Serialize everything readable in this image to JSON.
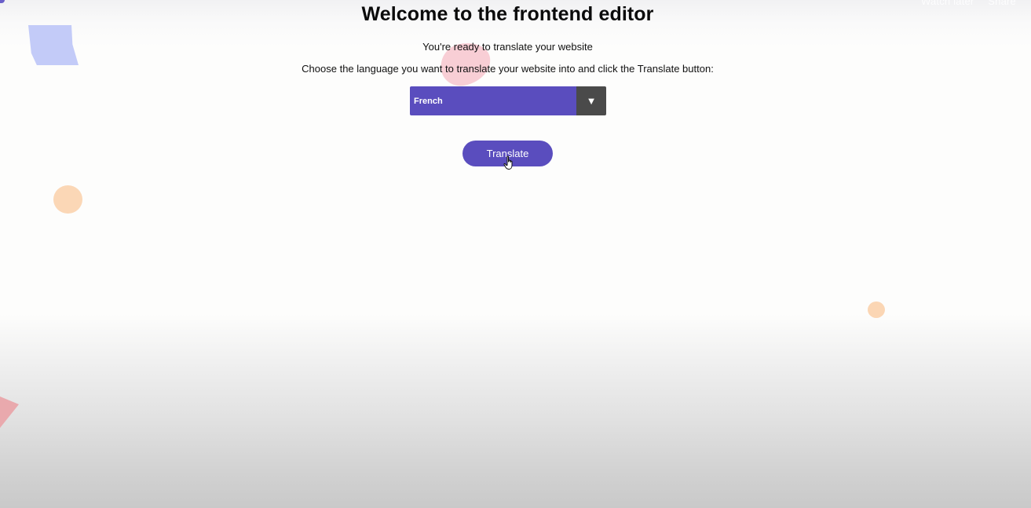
{
  "overlay": {
    "watch_later": "Watch later",
    "share": "Share"
  },
  "header": {
    "title": "Welcome to the frontend editor"
  },
  "main": {
    "subtitle": "You're ready to translate your website",
    "instruction": "Choose the language you want to translate your website into and click the Translate button:",
    "language_select": {
      "selected": "French",
      "arrow": "▼"
    },
    "translate_button": "Translate"
  },
  "colors": {
    "accent": "#5a4dbe",
    "select_arrow_bg": "#4a4a4a",
    "deco_blue": "#c3cbf8",
    "deco_peach": "#fbd7b6",
    "deco_pink": "#f6bec8"
  },
  "icons": {
    "select_arrow": "chevron-down-icon",
    "cursor": "hand-pointer-icon"
  }
}
